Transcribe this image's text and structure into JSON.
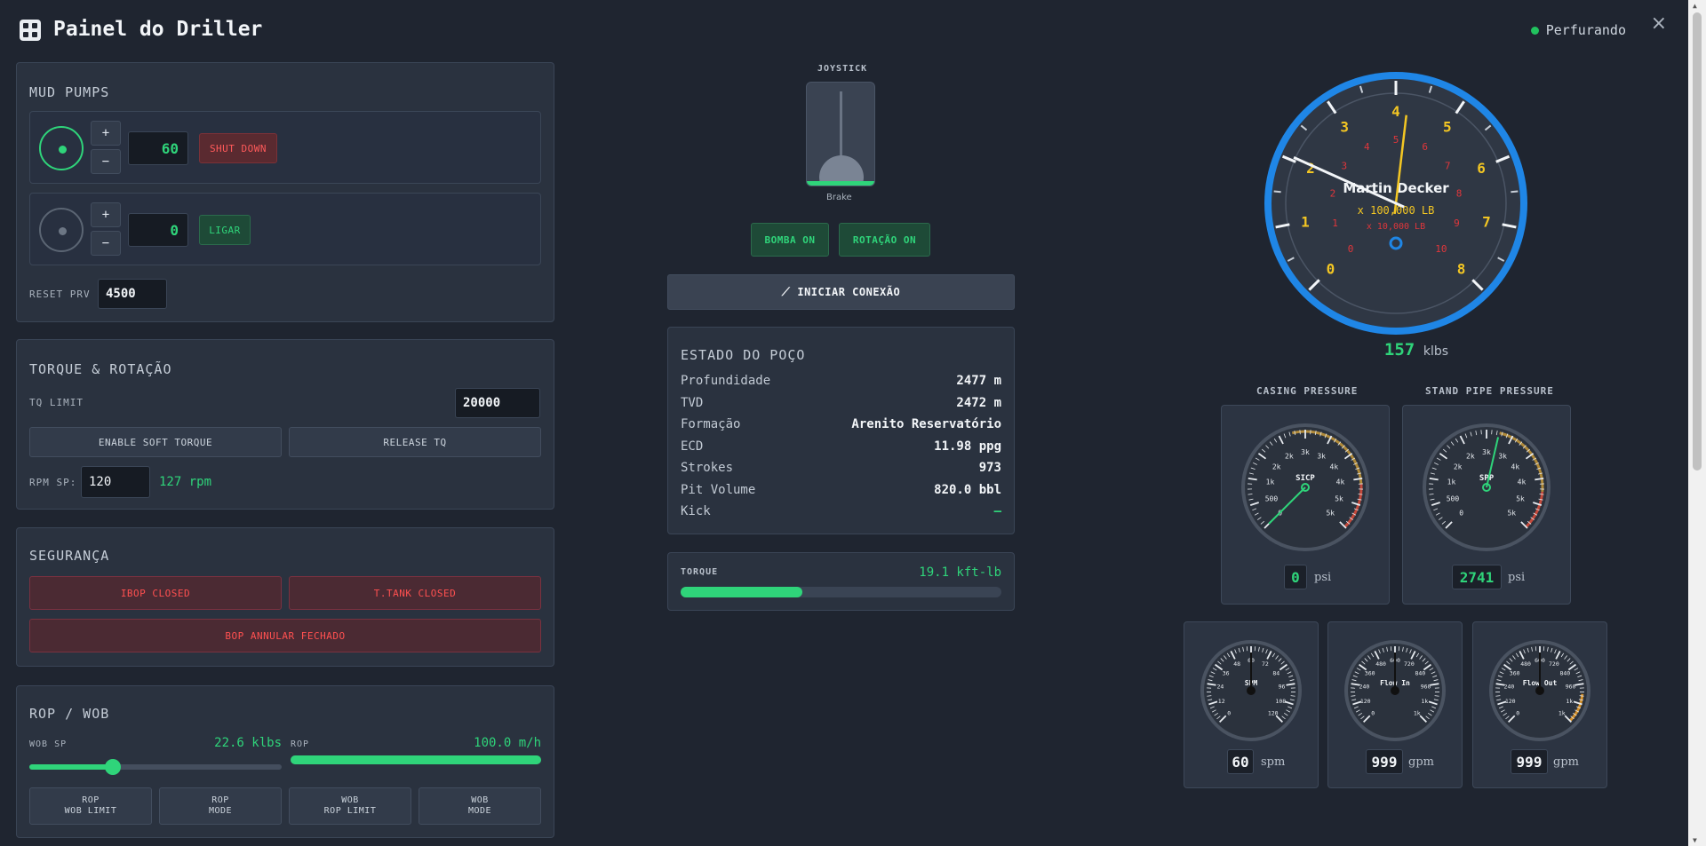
{
  "header": {
    "title": "Painel do Driller",
    "status": "Perfurando",
    "close": "×"
  },
  "mud_pumps": {
    "title": "MUD PUMPS",
    "pump1": {
      "value": "60",
      "action": "SHUT DOWN",
      "plus": "+",
      "minus": "−"
    },
    "pump2": {
      "value": "0",
      "action": "LIGAR",
      "plus": "+",
      "minus": "−"
    },
    "reset_prv_label": "RESET PRV",
    "reset_prv_value": "4500"
  },
  "torque": {
    "title": "TORQUE & ROTAÇÃO",
    "tq_limit_label": "TQ LIMIT",
    "tq_limit_value": "20000",
    "enable_soft": "ENABLE SOFT TORQUE",
    "release": "RELEASE TQ",
    "rpm_sp_label": "RPM SP:",
    "rpm_sp_value": "120",
    "rpm_actual": "127 rpm"
  },
  "seguranca": {
    "title": "SEGURANÇA",
    "ibop": "IBOP CLOSED",
    "ttank": "T.TANK CLOSED",
    "bop": "BOP ANNULAR FECHADO"
  },
  "rop_wob": {
    "title": "ROP / WOB",
    "wob_sp_label": "WOB SP",
    "wob_sp_value": "22.6 klbs",
    "wob_slider_fraction": 0.33,
    "rop_label": "ROP",
    "rop_value": "100.0 m/h",
    "rop_fraction": 1.0,
    "buttons": [
      {
        "l1": "ROP",
        "l2": "WOB LIMIT"
      },
      {
        "l1": "ROP",
        "l2": "MODE"
      },
      {
        "l1": "WOB",
        "l2": "ROP LIMIT"
      },
      {
        "l1": "WOB",
        "l2": "MODE"
      }
    ]
  },
  "joystick": {
    "label": "JOYSTICK",
    "brake": "Brake"
  },
  "center_buttons": {
    "bomba": "BOMBA ON",
    "rotacao": "ROTAÇÃO ON",
    "conexao": "INICIAR CONEXÃO"
  },
  "estado": {
    "title": "ESTADO DO POÇO",
    "rows": [
      {
        "k": "Profundidade",
        "v": "2477 m"
      },
      {
        "k": "TVD",
        "v": "2472 m"
      },
      {
        "k": "Formação",
        "v": "Arenito Reservatório"
      },
      {
        "k": "ECD",
        "v": "11.98 ppg"
      },
      {
        "k": "Strokes",
        "v": "973"
      },
      {
        "k": "Pit Volume",
        "v": "820.0 bbl"
      },
      {
        "k": "Kick",
        "v": "—"
      }
    ]
  },
  "torque_bar": {
    "label": "TORQUE",
    "value": "19.1 kft-lb",
    "fraction": 0.38
  },
  "martin_decker": {
    "title": "Martin Decker",
    "scale1": "x 100,000 LB",
    "scale2": "x 10,000 LB",
    "outer_ticks": [
      "0",
      "1",
      "2",
      "3",
      "4",
      "5",
      "6",
      "7",
      "8"
    ],
    "inner_ticks": [
      "0",
      "1",
      "2",
      "3",
      "4",
      "5",
      "6",
      "7",
      "8",
      "9",
      "10"
    ],
    "weight_value": "157",
    "weight_unit": "klbs",
    "colors": {
      "ring": "#1f86e6",
      "outer_num": "#f3c623",
      "inner_num": "#e0363b"
    }
  },
  "casing": {
    "title": "CASING PRESSURE",
    "label": "SICP",
    "ticks": [
      "0",
      "500",
      "1k",
      "2k",
      "2k",
      "3k",
      "3k",
      "4k",
      "4k",
      "5k",
      "5k"
    ],
    "value": "0",
    "unit": "psi"
  },
  "standpipe": {
    "title": "STAND PIPE PRESSURE",
    "label": "SPP",
    "ticks": [
      "0",
      "500",
      "1k",
      "2k",
      "2k",
      "3k",
      "3k",
      "4k",
      "4k",
      "5k",
      "5k"
    ],
    "value": "2741",
    "unit": "psi"
  },
  "spm": {
    "label": "SPM",
    "ticks": [
      "0",
      "12",
      "24",
      "36",
      "48",
      "60",
      "72",
      "84",
      "96",
      "108",
      "120"
    ],
    "value": "60",
    "unit": "spm"
  },
  "flow_in": {
    "label": "Flow In",
    "ticks": [
      "0",
      "120",
      "240",
      "360",
      "480",
      "600",
      "720",
      "840",
      "960",
      "1k",
      "1k"
    ],
    "value": "999",
    "unit": "gpm"
  },
  "flow_out": {
    "label": "Flow Out",
    "ticks": [
      "0",
      "120",
      "240",
      "360",
      "480",
      "600",
      "720",
      "840",
      "960",
      "1k",
      "1k"
    ],
    "value": "999",
    "unit": "gpm"
  }
}
